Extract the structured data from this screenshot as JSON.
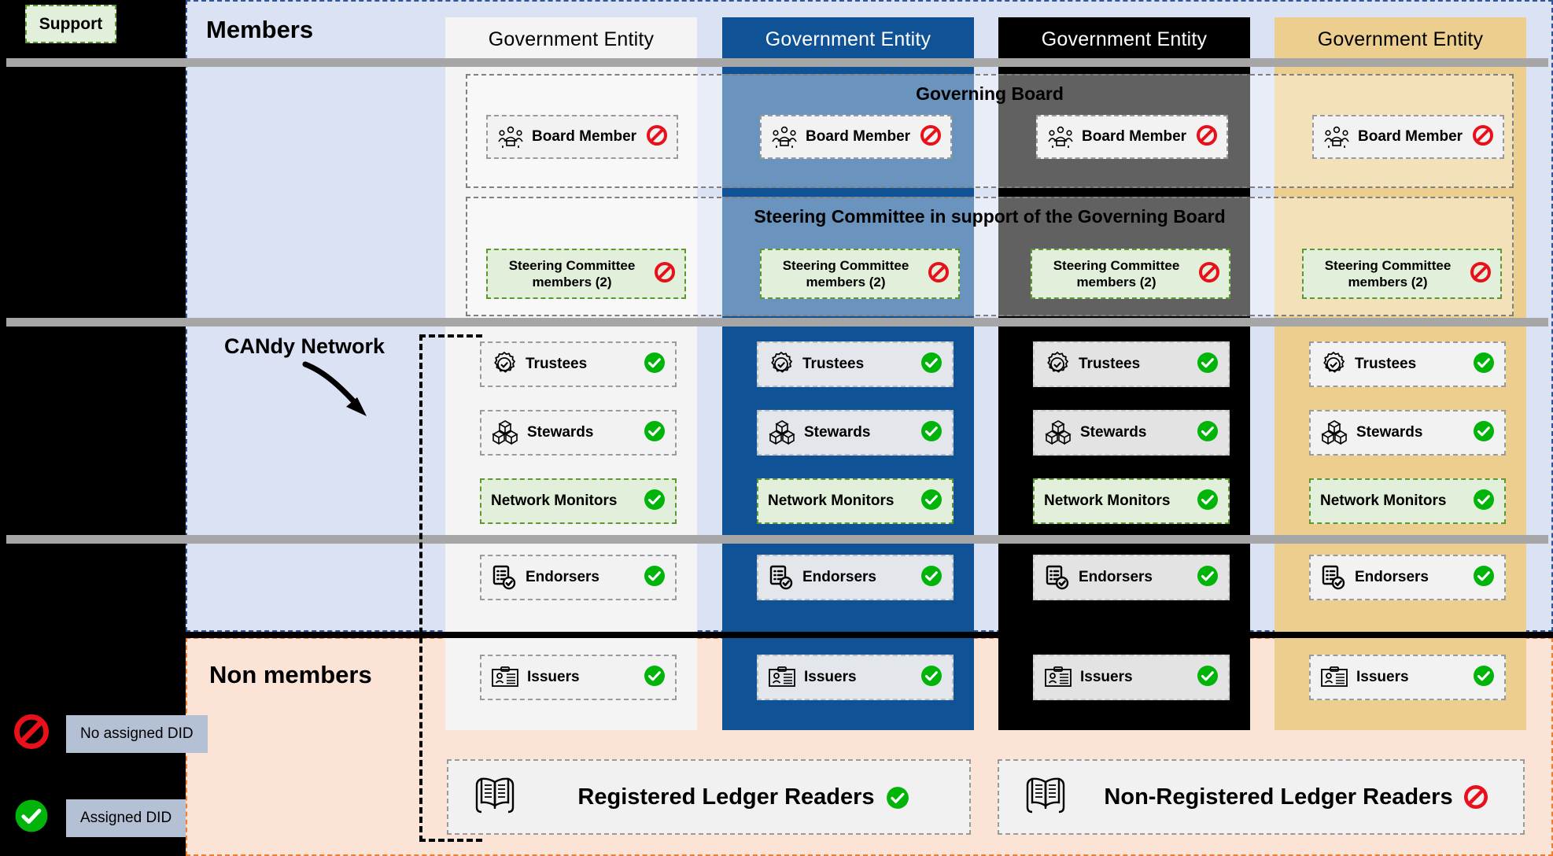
{
  "legend": {
    "support_label": "Support",
    "items": [
      {
        "icon": "no-entry-icon",
        "label": "No assigned DID"
      },
      {
        "icon": "check-circle-icon",
        "label": "Assigned DID"
      }
    ]
  },
  "bands": {
    "members_title": "Members",
    "nonmembers_title": "Non members",
    "members_color": "#dae2f3",
    "nonmembers_color": "#fbe4d5"
  },
  "annotation": {
    "candy_network_label": "CANdy Network"
  },
  "columns": [
    {
      "header": "Government Entity",
      "theme": "light",
      "color": "#f4f4f4"
    },
    {
      "header": "Government Entity",
      "theme": "blue",
      "color": "#0f5296"
    },
    {
      "header": "Government Entity",
      "theme": "black",
      "color": "#000000"
    },
    {
      "header": "Government Entity",
      "theme": "gold",
      "color": "#eccf8f"
    }
  ],
  "groups": [
    {
      "title": "Governing Board"
    },
    {
      "title": "Steering Committee in support of the Governing Board"
    }
  ],
  "board_members": [
    {
      "label": "Board Member",
      "icon": "board-members-icon",
      "status": "no-entry-icon"
    },
    {
      "label": "Board Member",
      "icon": "board-members-icon",
      "status": "no-entry-icon"
    },
    {
      "label": "Board Member",
      "icon": "board-members-icon",
      "status": "no-entry-icon"
    },
    {
      "label": "Board Member",
      "icon": "board-members-icon",
      "status": "no-entry-icon"
    }
  ],
  "steering_members": [
    {
      "label": "Steering Committee members (2)",
      "status": "no-entry-icon"
    },
    {
      "label": "Steering Committee members (2)",
      "status": "no-entry-icon"
    },
    {
      "label": "Steering Committee members (2)",
      "status": "no-entry-icon"
    },
    {
      "label": "Steering Committee members (2)",
      "status": "no-entry-icon"
    }
  ],
  "roles": {
    "trustees": {
      "label": "Trustees",
      "icon": "rosette-check-icon",
      "status": "check-circle-icon"
    },
    "stewards": {
      "label": "Stewards",
      "icon": "cubes-icon",
      "status": "check-circle-icon"
    },
    "network_monitors": {
      "label": "Network Monitors",
      "icon": "none",
      "status": "check-circle-icon"
    },
    "endorsers": {
      "label": "Endorsers",
      "icon": "clipboard-check-icon",
      "status": "check-circle-icon"
    },
    "issuers": {
      "label": "Issuers",
      "icon": "id-card-icon",
      "status": "check-circle-icon"
    }
  },
  "ledger_readers": [
    {
      "label": "Registered Ledger Readers",
      "icon": "open-book-icon",
      "status": "check-circle-icon"
    },
    {
      "label": "Non-Registered Ledger Readers",
      "icon": "open-book-icon",
      "status": "no-entry-icon"
    }
  ]
}
